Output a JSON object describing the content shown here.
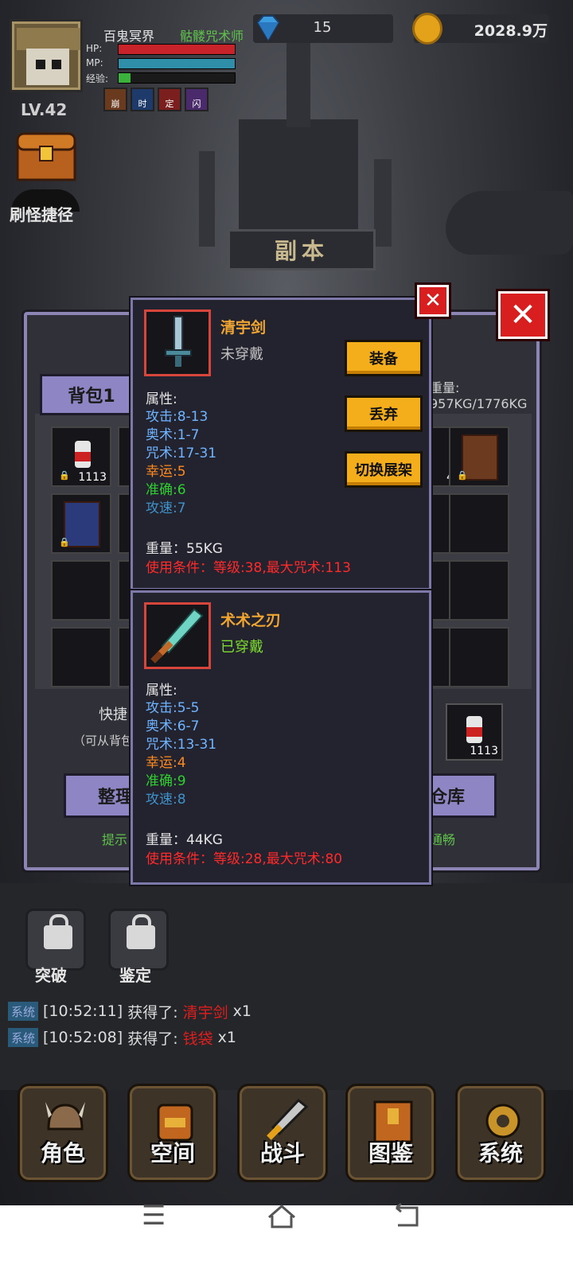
{
  "player": {
    "name": "百鬼冥界",
    "class": "骷髅咒术师",
    "level": "LV.42",
    "hp_label": "HP:",
    "mp_label": "MP:",
    "exp_label": "经验:",
    "hp": 1.0,
    "mp": 1.0,
    "exp": 0.1,
    "buffs": [
      "崩",
      "时",
      "定",
      "闪"
    ]
  },
  "currency": {
    "gems": "15",
    "gold": "2028.9万"
  },
  "shortcut": {
    "label": "刷怪捷径"
  },
  "dungeon": {
    "title": "副本"
  },
  "inventory": {
    "tab": "背包1",
    "weight_label": "重量:",
    "weight_value": "957KG/1776KG",
    "slot_count_1": "1113",
    "slot_count_2": "4",
    "quick_label": "快捷",
    "quick_hint": "（可从背包",
    "quick_count": "1113",
    "btn_sort": "整理",
    "btn_storage": "仓库",
    "hint_left": "提示",
    "hint_right": "通畅"
  },
  "item_new": {
    "name": "清宇剑",
    "state": "未穿戴",
    "attr_title": "属性:",
    "attrs": [
      "攻击:8-13",
      "奥术:1-7",
      "咒术:17-31",
      "幸运:5",
      "准确:6",
      "攻速:7"
    ],
    "weight": "重量：55KG",
    "requirement": "使用条件：等级:38,最大咒术:113",
    "btn_equip": "装备",
    "btn_discard": "丢弃",
    "btn_shelf": "切换展架"
  },
  "item_equipped": {
    "name": "术术之刃",
    "state": "已穿戴",
    "attr_title": "属性:",
    "attrs": [
      "攻击:5-5",
      "奥术:6-7",
      "咒术:13-31",
      "幸运:4",
      "准确:9",
      "攻速:8"
    ],
    "weight": "重量：44KG",
    "requirement": "使用条件：等级:28,最大咒术:80"
  },
  "locked": {
    "break": "突破",
    "identify": "鉴定"
  },
  "log": [
    {
      "tag": "系统",
      "time": "[10:52:11]",
      "text": "获得了:",
      "item": "清宇剑",
      "qty": "x1"
    },
    {
      "tag": "系统",
      "time": "[10:52:08]",
      "text": "获得了:",
      "item": "钱袋",
      "qty": "x1"
    }
  ],
  "nav": [
    "角色",
    "空间",
    "战斗",
    "图鉴",
    "系统"
  ],
  "colors": {
    "attack": "#6fb4ff",
    "arcane": "#6fb4ff",
    "curse": "#6fb4ff",
    "luck": "#ff8a1e",
    "accuracy": "#2fd02f",
    "speed": "#3f92c9",
    "equipped": "#7cdc2e",
    "unequipped": "#c0c0c0"
  },
  "icons": {
    "gem": "diamond-icon",
    "gold": "coin-icon",
    "menu": "menu-icon",
    "home": "home-icon",
    "back": "back-icon"
  }
}
